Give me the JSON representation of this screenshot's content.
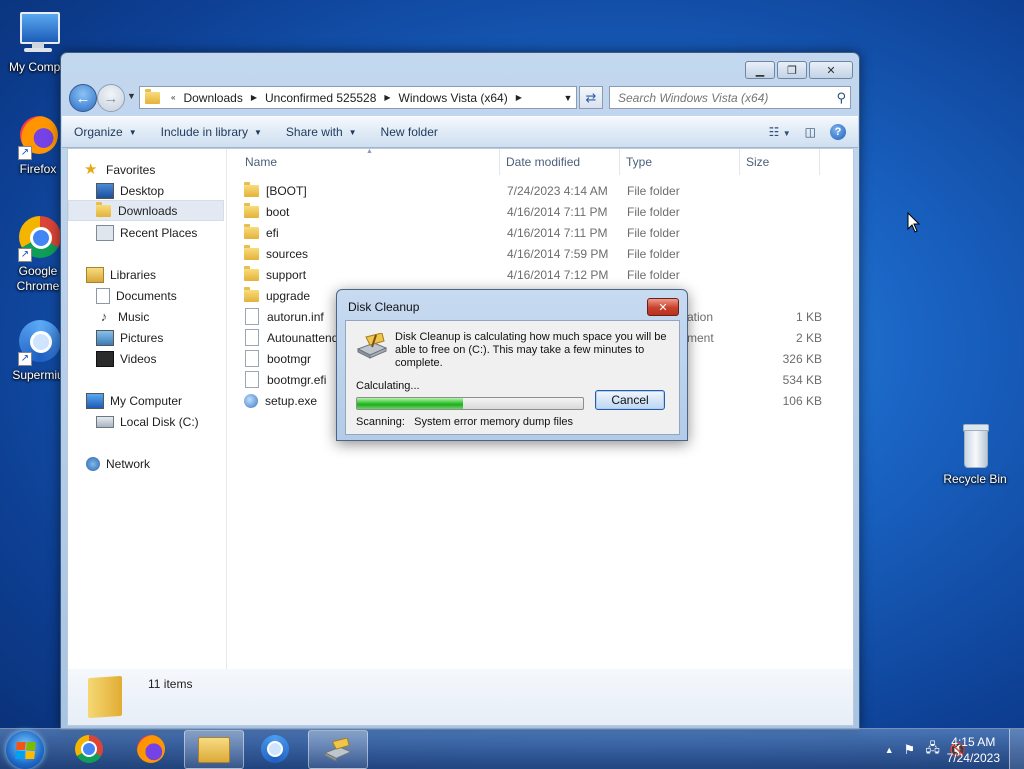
{
  "desktop": {
    "icons": [
      {
        "label": "My Compu"
      },
      {
        "label": "Firefox"
      },
      {
        "label": "Google Chrome"
      },
      {
        "label": "Supermiu"
      },
      {
        "label": "Recycle Bin"
      }
    ]
  },
  "explorer": {
    "address": {
      "overflow": "«",
      "crumbs": [
        "Downloads",
        "Unconfirmed 525528",
        "Windows Vista (x64)"
      ]
    },
    "search_placeholder": "Search Windows Vista (x64)",
    "toolbar": {
      "organize": "Organize",
      "include_in_library": "Include in library",
      "share_with": "Share with",
      "new_folder": "New folder"
    },
    "nav": {
      "favorites": "Favorites",
      "desktop": "Desktop",
      "downloads": "Downloads",
      "recent_places": "Recent Places",
      "libraries": "Libraries",
      "documents": "Documents",
      "music": "Music",
      "pictures": "Pictures",
      "videos": "Videos",
      "my_computer": "My Computer",
      "local_disk": "Local Disk (C:)",
      "network": "Network"
    },
    "columns": {
      "name": "Name",
      "date_modified": "Date modified",
      "type": "Type",
      "size": "Size"
    },
    "files": [
      {
        "name": "[BOOT]",
        "date": "7/24/2023 4:14 AM",
        "type": "File folder",
        "size": ""
      },
      {
        "name": "boot",
        "date": "4/16/2014 7:11 PM",
        "type": "File folder",
        "size": ""
      },
      {
        "name": "efi",
        "date": "4/16/2014 7:11 PM",
        "type": "File folder",
        "size": ""
      },
      {
        "name": "sources",
        "date": "4/16/2014 7:59 PM",
        "type": "File folder",
        "size": ""
      },
      {
        "name": "support",
        "date": "4/16/2014 7:12 PM",
        "type": "File folder",
        "size": ""
      },
      {
        "name": "upgrade",
        "date": "",
        "type": "",
        "size": ""
      },
      {
        "name": "autorun.inf",
        "date": "",
        "type": "mation",
        "size": "1 KB"
      },
      {
        "name": "Autounattend",
        "date": "",
        "type": "ment",
        "size": "2 KB"
      },
      {
        "name": "bootmgr",
        "date": "",
        "type": "",
        "size": "326 KB"
      },
      {
        "name": "bootmgr.efi",
        "date": "",
        "type": "",
        "size": "534 KB"
      },
      {
        "name": "setup.exe",
        "date": "",
        "type": "",
        "size": "106 KB"
      }
    ],
    "status_count": "11 items"
  },
  "dialog": {
    "title": "Disk Cleanup",
    "close": "✕",
    "message": "Disk Cleanup is calculating how much space you will be able to free on  (C:). This may take a few minutes to complete.",
    "calculating": "Calculating...",
    "progress": 0.47,
    "cancel": "Cancel",
    "scanning_label": "Scanning:",
    "scanning_item": "System error memory dump files"
  },
  "taskbar": {
    "time": "4:15 AM",
    "date": "7/24/2023"
  }
}
